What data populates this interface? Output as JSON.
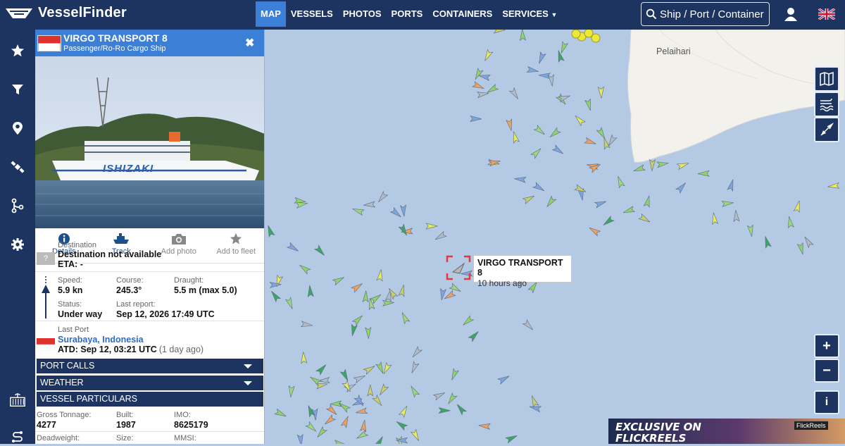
{
  "app": {
    "brand": "VesselFinder",
    "nav": [
      "MAP",
      "VESSELS",
      "PHOTOS",
      "PORTS",
      "CONTAINERS",
      "SERVICES"
    ],
    "active_nav": "MAP",
    "search_placeholder": "Ship / Port / Container"
  },
  "leftnav": [
    "star-icon",
    "filter-icon",
    "location-pin-icon",
    "satellite-icon",
    "route-icon",
    "settings-icon",
    "container-icon",
    "route-lines-icon"
  ],
  "vessel": {
    "name": "VIRGO TRANSPORT 8",
    "type": "Passenger/Ro-Ro Cargo Ship",
    "hull_text": "ISHIZAKI",
    "actions": [
      {
        "label": "Details",
        "icon": "info-icon",
        "enabled": true
      },
      {
        "label": "Track",
        "icon": "ship-icon",
        "enabled": true
      },
      {
        "label": "Add photo",
        "icon": "camera-icon",
        "enabled": false
      },
      {
        "label": "Add to fleet",
        "icon": "star-icon",
        "enabled": false
      }
    ],
    "destination_label": "Destination",
    "destination_value": "Destination not available",
    "eta_value": "ETA: -",
    "unknown_badge": "?",
    "speed_label": "Speed:",
    "speed_value": "5.9 kn",
    "course_label": "Course:",
    "course_value": "245.3°",
    "draught_label": "Draught:",
    "draught_value": "5.5 m (max 5.0)",
    "status_label": "Status:",
    "status_value": "Under way",
    "last_report_label": "Last report:",
    "last_report_value": "Sep 12, 2026 17:49 UTC",
    "last_port_label": "Last Port",
    "last_port_value": "Surabaya, Indonesia",
    "atd_value": "ATD: Sep 12, 03:21 UTC",
    "atd_ago": "(1 day ago)",
    "sections": [
      "PORT CALLS",
      "WEATHER",
      "VESSEL PARTICULARS"
    ],
    "gross_label": "Gross Tonnage:",
    "gross_value": "4277",
    "built_label": "Built:",
    "built_value": "1987",
    "imo_label": "IMO:",
    "imo_value": "8625179",
    "deadweight_label": "Deadweight:",
    "size_label": "Size:",
    "mmsi_label": "MMSI:"
  },
  "map": {
    "place_label": "Pelaihari",
    "tooltip_name": "VIRGO TRANSPORT 8",
    "tooltip_time": "10 hours ago",
    "zoom_in": "+",
    "zoom_out": "−",
    "info": "i",
    "ad_line1": "EXCLUSIVE ON",
    "ad_line2": "FLICKREELS",
    "ad_brand": "FlickReels",
    "colors": {
      "water": "#b4c9e4",
      "land": "#f3f1ec",
      "nav": "#1d3461",
      "accent": "#3b7fd6"
    }
  }
}
